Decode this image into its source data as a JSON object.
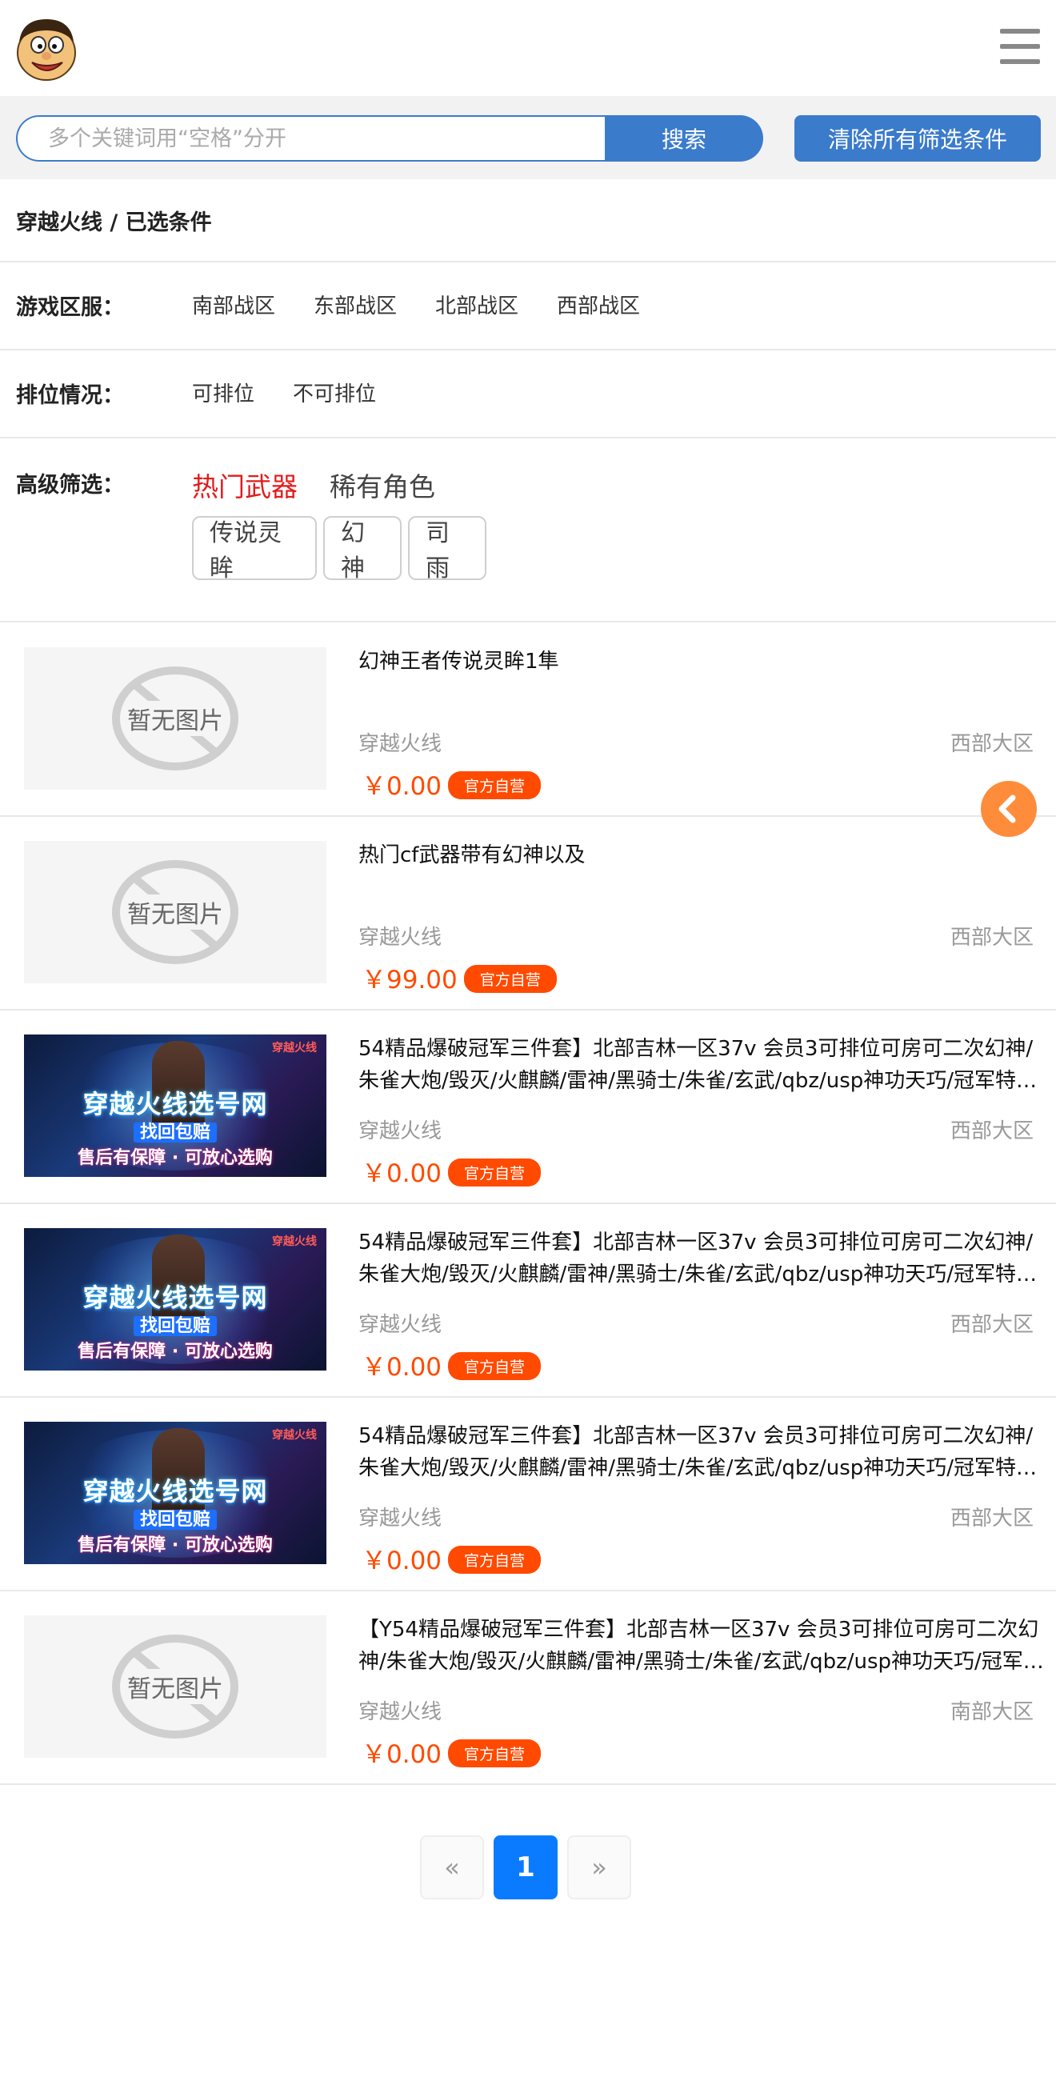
{
  "search": {
    "placeholder": "多个关键词用“空格”分开",
    "button_label": "搜索",
    "clear_label": "清除所有筛选条件"
  },
  "breadcrumb": "穿越火线 / 已选条件",
  "filters": {
    "region": {
      "label": "游戏区服：",
      "options": [
        "南部战区",
        "东部战区",
        "北部战区",
        "西部战区"
      ]
    },
    "ranking": {
      "label": "排位情况：",
      "options": [
        "可排位",
        "不可排位"
      ]
    },
    "advanced": {
      "label": "高级筛选：",
      "tabs": [
        "热门武器",
        "稀有角色"
      ],
      "active_tab": 0,
      "chips": [
        "传说灵眸",
        "幻神",
        "司雨"
      ]
    }
  },
  "products": [
    {
      "title": "幻神王者传说灵眸1隼",
      "game": "穿越火线",
      "region": "西部大区",
      "price": "￥0.00",
      "badge": "官方自营",
      "image": "no-image",
      "no_image_text": "暂无图片"
    },
    {
      "title": "热门cf武器带有幻神以及",
      "game": "穿越火线",
      "region": "西部大区",
      "price": "￥99.00",
      "badge": "官方自营",
      "image": "no-image",
      "no_image_text": "暂无图片"
    },
    {
      "title": "54精品爆破冠军三件套】北部吉林一区37v 会员3可排位可房可二次幻神/朱雀大炮/毁灭/火麒麟/雷神/黑骑士/朱雀/玄武/qbz/usp神功天巧/冠军特冠...",
      "game": "穿越火线",
      "region": "西部大区",
      "price": "￥0.00",
      "badge": "官方自营",
      "image": "banner",
      "banner": {
        "title": "穿越火线选号网",
        "line2": "找回包赔",
        "line3": "售后有保障 · 可放心选购",
        "brand": "穿越火线"
      }
    },
    {
      "title": "54精品爆破冠军三件套】北部吉林一区37v 会员3可排位可房可二次幻神/朱雀大炮/毁灭/火麒麟/雷神/黑骑士/朱雀/玄武/qbz/usp神功天巧/冠军特冠...",
      "game": "穿越火线",
      "region": "西部大区",
      "price": "￥0.00",
      "badge": "官方自营",
      "image": "banner",
      "banner": {
        "title": "穿越火线选号网",
        "line2": "找回包赔",
        "line3": "售后有保障 · 可放心选购",
        "brand": "穿越火线"
      }
    },
    {
      "title": "54精品爆破冠军三件套】北部吉林一区37v 会员3可排位可房可二次幻神/朱雀大炮/毁灭/火麒麟/雷神/黑骑士/朱雀/玄武/qbz/usp神功天巧/冠军特冠...",
      "game": "穿越火线",
      "region": "西部大区",
      "price": "￥0.00",
      "badge": "官方自营",
      "image": "banner",
      "banner": {
        "title": "穿越火线选号网",
        "line2": "找回包赔",
        "line3": "售后有保障 · 可放心选购",
        "brand": "穿越火线"
      }
    },
    {
      "title": "【Y54精品爆破冠军三件套】北部吉林一区37v 会员3可排位可房可二次幻神/朱雀大炮/毁灭/火麒麟/雷神/黑骑士/朱雀/玄武/qbz/usp神功天巧/冠军特...",
      "game": "穿越火线",
      "region": "南部大区",
      "price": "￥0.00",
      "badge": "官方自营",
      "image": "no-image",
      "no_image_text": "暂无图片"
    }
  ],
  "pagination": {
    "prev": "«",
    "current": "1",
    "next": "»"
  },
  "colors": {
    "primary": "#3b7bcc",
    "price": "#ff4a00",
    "active_tab": "#e31b1b",
    "float_button": "#ff8c3a",
    "page_active": "#0a7bff"
  },
  "icons": {
    "logo": "cartoon-face-logo",
    "menu": "hamburger-menu-icon",
    "float": "chevron-left-icon"
  }
}
